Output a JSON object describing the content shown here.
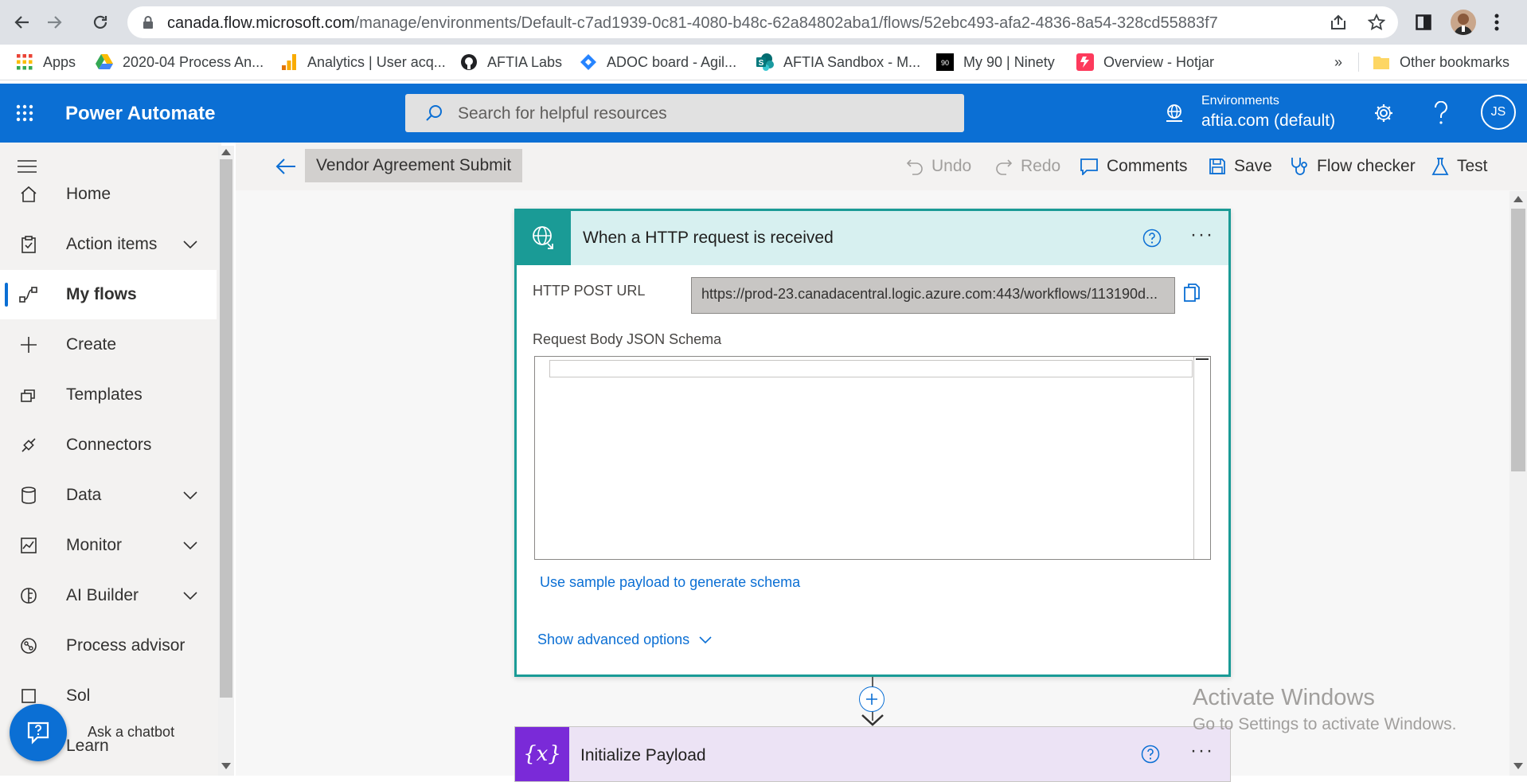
{
  "browser": {
    "url_host": "canada.flow.microsoft.com",
    "url_path": "/manage/environments/Default-c7ad1939-0c81-4080-b48c-62a84802aba1/flows/52ebc493-afa2-4836-8a54-328cd55883f7",
    "bookmarks": [
      {
        "label": "Apps",
        "icon": "apps-grid-icon"
      },
      {
        "label": "2020-04 Process An...",
        "icon": "google-drive-icon"
      },
      {
        "label": "Analytics | User acq...",
        "icon": "analytics-icon"
      },
      {
        "label": "AFTIA Labs",
        "icon": "github-icon"
      },
      {
        "label": "ADOC board - Agil...",
        "icon": "jira-icon"
      },
      {
        "label": "AFTIA Sandbox - M...",
        "icon": "sharepoint-icon"
      },
      {
        "label": "My 90 | Ninety",
        "icon": "ninety-icon"
      },
      {
        "label": "Overview - Hotjar",
        "icon": "hotjar-icon"
      }
    ],
    "more_bookmarks": "»",
    "other_bookmarks": "Other bookmarks"
  },
  "header": {
    "app_name": "Power Automate",
    "search_placeholder": "Search for helpful resources",
    "environments_label": "Environments",
    "environment_value": "aftia.com (default)",
    "avatar_initials": "JS"
  },
  "sidebar": {
    "items": [
      {
        "label": "Home",
        "icon": "home-icon",
        "chevron": false
      },
      {
        "label": "Action items",
        "icon": "clipboard-icon",
        "chevron": true
      },
      {
        "label": "My flows",
        "icon": "flow-icon",
        "chevron": false,
        "active": true
      },
      {
        "label": "Create",
        "icon": "plus-icon",
        "chevron": false
      },
      {
        "label": "Templates",
        "icon": "templates-icon",
        "chevron": false
      },
      {
        "label": "Connectors",
        "icon": "connector-icon",
        "chevron": false
      },
      {
        "label": "Data",
        "icon": "database-icon",
        "chevron": true
      },
      {
        "label": "Monitor",
        "icon": "monitor-icon",
        "chevron": true
      },
      {
        "label": "AI Builder",
        "icon": "brain-icon",
        "chevron": true
      },
      {
        "label": "Process advisor",
        "icon": "process-advisor-icon",
        "chevron": false
      },
      {
        "label": "Sol",
        "icon": "solutions-icon",
        "chevron": false
      },
      {
        "label": "Learn",
        "icon": "book-icon",
        "chevron": false
      }
    ],
    "chatbot_label": "Ask a chatbot"
  },
  "toolbar": {
    "flow_name": "Vendor Agreement Submit",
    "undo": "Undo",
    "redo": "Redo",
    "comments": "Comments",
    "save": "Save",
    "flow_checker": "Flow checker",
    "test": "Test"
  },
  "trigger": {
    "title": "When a HTTP request is received",
    "post_url_label": "HTTP POST URL",
    "post_url_value": "https://prod-23.canadacentral.logic.azure.com:443/workflows/113190d...",
    "schema_label": "Request Body JSON Schema",
    "sample_link": "Use sample payload to generate schema",
    "advanced_link": "Show advanced options",
    "more": "···",
    "help": "?"
  },
  "next_action": {
    "title": "Initialize Payload",
    "icon_text": "{x}",
    "more": "···",
    "help": "?"
  },
  "watermark": {
    "title": "Activate Windows",
    "subtitle": "Go to Settings to activate Windows."
  },
  "colors": {
    "brand": "#0b6fd4",
    "trigger_accent": "#1a9b96",
    "variable_accent": "#7a2ad8"
  }
}
